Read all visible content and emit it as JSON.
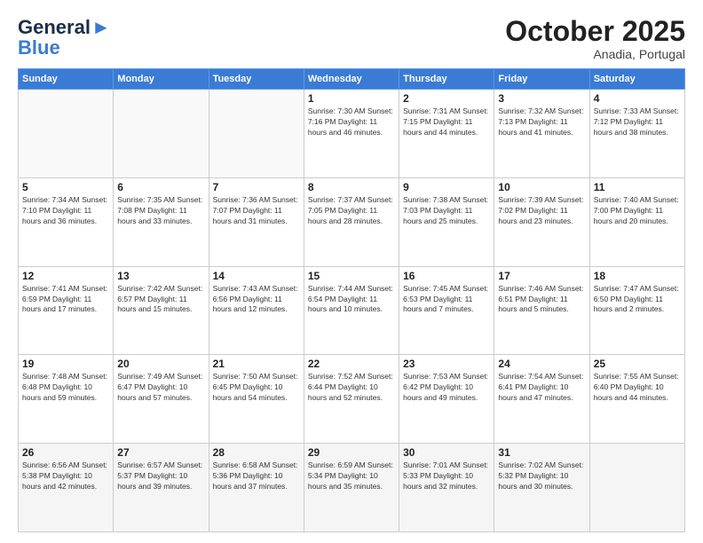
{
  "header": {
    "logo": {
      "general": "General",
      "blue": "Blue"
    },
    "month": "October 2025",
    "location": "Anadia, Portugal"
  },
  "weekdays": [
    "Sunday",
    "Monday",
    "Tuesday",
    "Wednesday",
    "Thursday",
    "Friday",
    "Saturday"
  ],
  "weeks": [
    [
      {
        "day": "",
        "info": ""
      },
      {
        "day": "",
        "info": ""
      },
      {
        "day": "",
        "info": ""
      },
      {
        "day": "1",
        "info": "Sunrise: 7:30 AM\nSunset: 7:16 PM\nDaylight: 11 hours\nand 46 minutes."
      },
      {
        "day": "2",
        "info": "Sunrise: 7:31 AM\nSunset: 7:15 PM\nDaylight: 11 hours\nand 44 minutes."
      },
      {
        "day": "3",
        "info": "Sunrise: 7:32 AM\nSunset: 7:13 PM\nDaylight: 11 hours\nand 41 minutes."
      },
      {
        "day": "4",
        "info": "Sunrise: 7:33 AM\nSunset: 7:12 PM\nDaylight: 11 hours\nand 38 minutes."
      }
    ],
    [
      {
        "day": "5",
        "info": "Sunrise: 7:34 AM\nSunset: 7:10 PM\nDaylight: 11 hours\nand 36 minutes."
      },
      {
        "day": "6",
        "info": "Sunrise: 7:35 AM\nSunset: 7:08 PM\nDaylight: 11 hours\nand 33 minutes."
      },
      {
        "day": "7",
        "info": "Sunrise: 7:36 AM\nSunset: 7:07 PM\nDaylight: 11 hours\nand 31 minutes."
      },
      {
        "day": "8",
        "info": "Sunrise: 7:37 AM\nSunset: 7:05 PM\nDaylight: 11 hours\nand 28 minutes."
      },
      {
        "day": "9",
        "info": "Sunrise: 7:38 AM\nSunset: 7:03 PM\nDaylight: 11 hours\nand 25 minutes."
      },
      {
        "day": "10",
        "info": "Sunrise: 7:39 AM\nSunset: 7:02 PM\nDaylight: 11 hours\nand 23 minutes."
      },
      {
        "day": "11",
        "info": "Sunrise: 7:40 AM\nSunset: 7:00 PM\nDaylight: 11 hours\nand 20 minutes."
      }
    ],
    [
      {
        "day": "12",
        "info": "Sunrise: 7:41 AM\nSunset: 6:59 PM\nDaylight: 11 hours\nand 17 minutes."
      },
      {
        "day": "13",
        "info": "Sunrise: 7:42 AM\nSunset: 6:57 PM\nDaylight: 11 hours\nand 15 minutes."
      },
      {
        "day": "14",
        "info": "Sunrise: 7:43 AM\nSunset: 6:56 PM\nDaylight: 11 hours\nand 12 minutes."
      },
      {
        "day": "15",
        "info": "Sunrise: 7:44 AM\nSunset: 6:54 PM\nDaylight: 11 hours\nand 10 minutes."
      },
      {
        "day": "16",
        "info": "Sunrise: 7:45 AM\nSunset: 6:53 PM\nDaylight: 11 hours\nand 7 minutes."
      },
      {
        "day": "17",
        "info": "Sunrise: 7:46 AM\nSunset: 6:51 PM\nDaylight: 11 hours\nand 5 minutes."
      },
      {
        "day": "18",
        "info": "Sunrise: 7:47 AM\nSunset: 6:50 PM\nDaylight: 11 hours\nand 2 minutes."
      }
    ],
    [
      {
        "day": "19",
        "info": "Sunrise: 7:48 AM\nSunset: 6:48 PM\nDaylight: 10 hours\nand 59 minutes."
      },
      {
        "day": "20",
        "info": "Sunrise: 7:49 AM\nSunset: 6:47 PM\nDaylight: 10 hours\nand 57 minutes."
      },
      {
        "day": "21",
        "info": "Sunrise: 7:50 AM\nSunset: 6:45 PM\nDaylight: 10 hours\nand 54 minutes."
      },
      {
        "day": "22",
        "info": "Sunrise: 7:52 AM\nSunset: 6:44 PM\nDaylight: 10 hours\nand 52 minutes."
      },
      {
        "day": "23",
        "info": "Sunrise: 7:53 AM\nSunset: 6:42 PM\nDaylight: 10 hours\nand 49 minutes."
      },
      {
        "day": "24",
        "info": "Sunrise: 7:54 AM\nSunset: 6:41 PM\nDaylight: 10 hours\nand 47 minutes."
      },
      {
        "day": "25",
        "info": "Sunrise: 7:55 AM\nSunset: 6:40 PM\nDaylight: 10 hours\nand 44 minutes."
      }
    ],
    [
      {
        "day": "26",
        "info": "Sunrise: 6:56 AM\nSunset: 5:38 PM\nDaylight: 10 hours\nand 42 minutes."
      },
      {
        "day": "27",
        "info": "Sunrise: 6:57 AM\nSunset: 5:37 PM\nDaylight: 10 hours\nand 39 minutes."
      },
      {
        "day": "28",
        "info": "Sunrise: 6:58 AM\nSunset: 5:36 PM\nDaylight: 10 hours\nand 37 minutes."
      },
      {
        "day": "29",
        "info": "Sunrise: 6:59 AM\nSunset: 5:34 PM\nDaylight: 10 hours\nand 35 minutes."
      },
      {
        "day": "30",
        "info": "Sunrise: 7:01 AM\nSunset: 5:33 PM\nDaylight: 10 hours\nand 32 minutes."
      },
      {
        "day": "31",
        "info": "Sunrise: 7:02 AM\nSunset: 5:32 PM\nDaylight: 10 hours\nand 30 minutes."
      },
      {
        "day": "",
        "info": ""
      }
    ]
  ]
}
